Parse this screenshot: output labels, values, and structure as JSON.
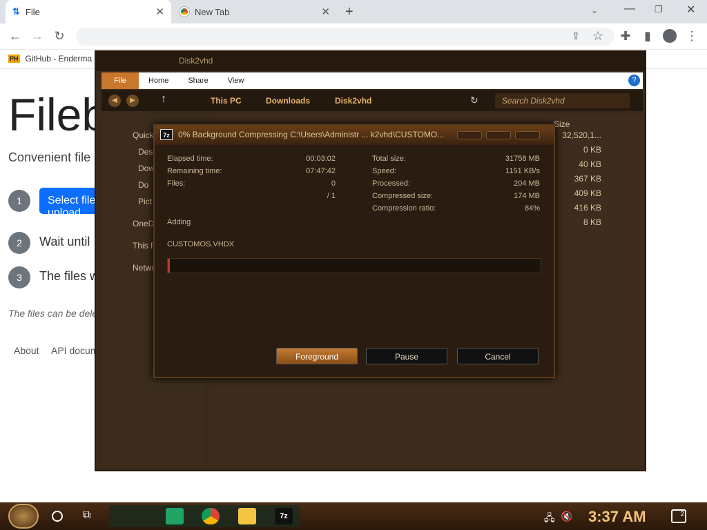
{
  "browser": {
    "tabs": [
      {
        "title": "File",
        "active": true
      },
      {
        "title": "New Tab",
        "active": false
      }
    ],
    "bookmark": "GitHub - Enderma",
    "colors": {
      "accent": "#0d6efd",
      "tabstrip": "#dee1e6"
    }
  },
  "filebin": {
    "title": "Filebin",
    "subtitle": "Convenient file sharing",
    "steps": [
      {
        "num": "1",
        "text": "Select files to upload"
      },
      {
        "num": "2",
        "text": "Wait until"
      },
      {
        "num": "3",
        "text": "The files will be available at a unique link that you can share."
      }
    ],
    "select_button": "Select files to upload",
    "note": "The files can be deleted manually",
    "footer": [
      "About",
      "API documentation"
    ]
  },
  "explorer": {
    "title": "Disk2vhd",
    "ribbon_tabs": [
      "File",
      "Home",
      "Share",
      "View"
    ],
    "breadcrumb": [
      "This PC",
      "Downloads",
      "Disk2vhd"
    ],
    "search_placeholder": "Search Disk2vhd",
    "nav_items": [
      "Quick",
      "Des",
      "Dow",
      "Do",
      "Pict",
      "OneD",
      "This P",
      "Netwo"
    ],
    "size_header": "Size",
    "sizes": [
      "32,520,1...",
      "0 KB",
      "40 KB",
      "367 KB",
      "409 KB",
      "416 KB",
      "8 KB"
    ]
  },
  "dialog": {
    "title": "0% Background Compressing C:\\Users\\Administr ... k2vhd\\CUSTOMO...",
    "icon": "7z",
    "left_labels": [
      "Elapsed time:",
      "Remaining time:",
      "Files:"
    ],
    "left_values": [
      "00:03:02",
      "07:47:42",
      "0"
    ],
    "files_total": "/ 1",
    "right_labels": [
      "Total size:",
      "Speed:",
      "Processed:",
      "Compressed size:",
      "Compression ratio:"
    ],
    "right_values": [
      "31758 MB",
      "1151 KB/s",
      "204 MB",
      "174 MB",
      "84%"
    ],
    "status": "Adding",
    "current_file": "CUSTOMOS.VHDX",
    "progress_fraction": 0.0,
    "buttons": [
      "Foreground",
      "Pause",
      "Cancel"
    ]
  },
  "taskbar": {
    "time": "3:37 AM",
    "notification_count": "2",
    "apps": [
      "spreadsheet-icon",
      "chrome-icon",
      "folder-icon",
      "7zip-icon"
    ]
  }
}
